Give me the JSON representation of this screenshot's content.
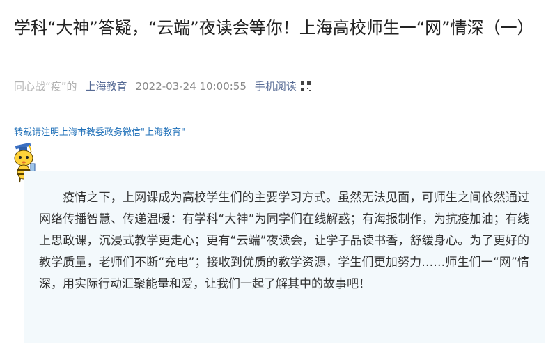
{
  "article": {
    "title": "学科“大神”答疑，“云端”夜读会等你！上海高校师生一“网”情深（一）",
    "column": "同心战“疫”的",
    "account": "上海教育",
    "date": "2022-03-24 10:00:55",
    "mobile_read": "手机阅读",
    "notice": "转载请注明上海市教委政务微信\"上海教育\"",
    "intro": "疫情之下，上网课成为高校学生们的主要学习方式。虽然无法见面，可师生之间依然通过网络传播智慧、传递温暖：有学科“大神”为同学们在线解惑；有海报制作，为抗疫加油；有线上思政课，沉浸式教学更走心；更有“云端”夜读会，让学子品读书香，舒缓身心。为了更好的教学质量，老师们不断“充电”；接收到优质的教学资源，学生们更加努力……师生们一“网”情深，用实际行动汇聚能量和爱，让我们一起了解其中的故事吧！"
  },
  "colors": {
    "link": "#576b95",
    "notice": "#1e6fb8",
    "box_bg": "#f3f9fc"
  },
  "icons": [
    "qr-code-icon",
    "bee-mascot-icon"
  ]
}
